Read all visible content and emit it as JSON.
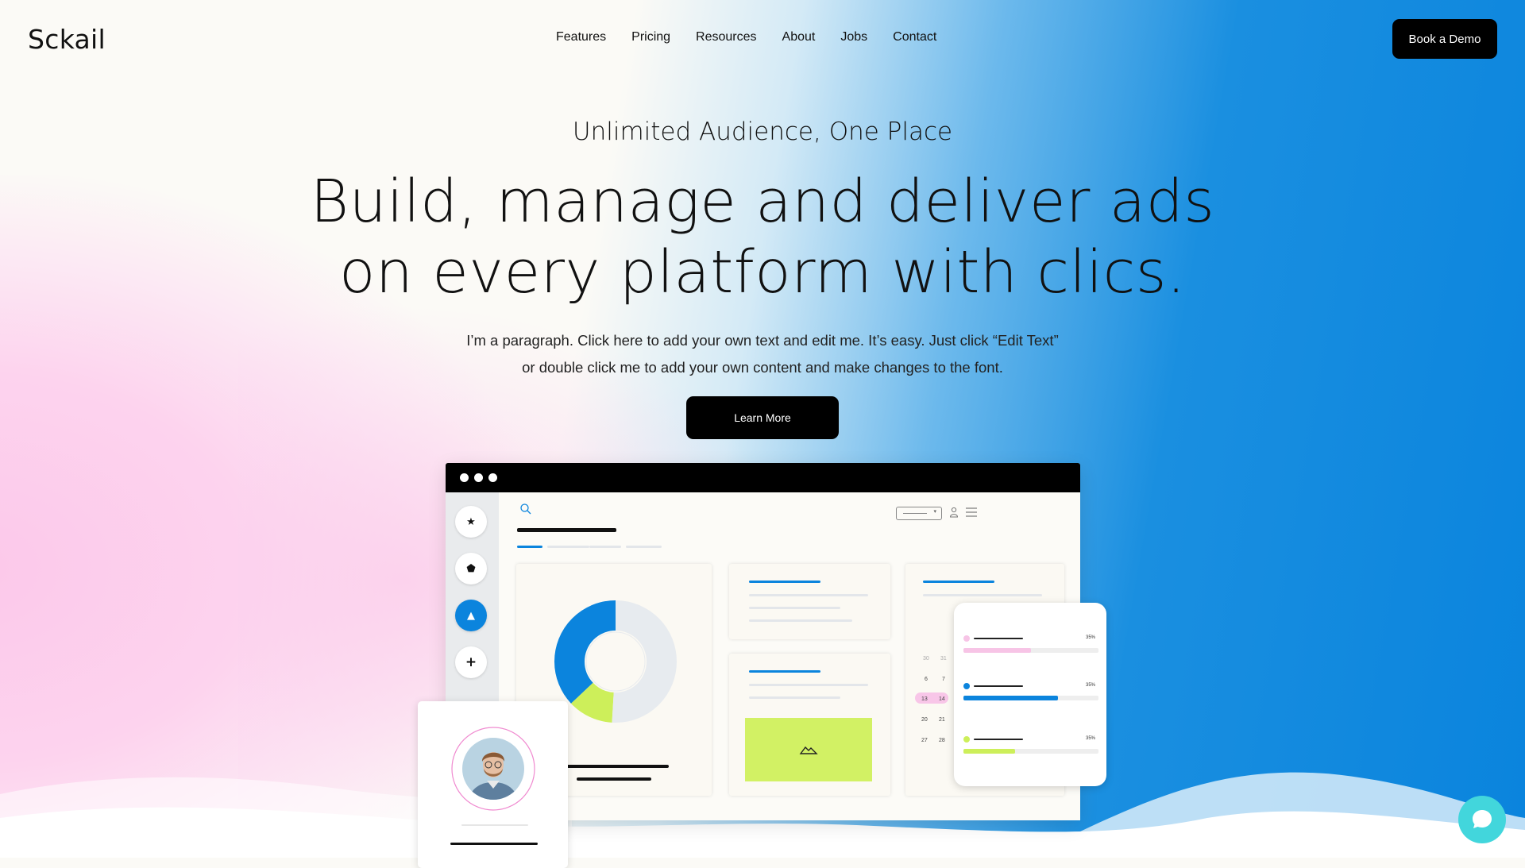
{
  "brand": {
    "name": "Sckail"
  },
  "nav": {
    "items": [
      "Features",
      "Pricing",
      "Resources",
      "About",
      "Jobs",
      "Contact"
    ],
    "cta": "Book a Demo"
  },
  "hero": {
    "eyebrow": "Unlimited Audience, One Place",
    "title_line1": "Build, manage and deliver ads",
    "title_line2": "on every platform with clics.",
    "paragraph_line1": "I’m a paragraph. Click here to add your own text and edit me. It’s easy. Just click “Edit Text”",
    "paragraph_line2": "or double click me to add your own content and make changes to the font.",
    "cta": "Learn More"
  },
  "mockup": {
    "sidebar_icons": [
      "star-icon",
      "pentagon-icon",
      "triangle-icon",
      "plus-icon"
    ],
    "active_sidebar_index": 2,
    "donut_segments": [
      {
        "color": "#0b84dd",
        "fraction": 0.37
      },
      {
        "color": "#cdef5a",
        "fraction": 0.12
      },
      {
        "color": "#e7ebef",
        "fraction": 0.51
      }
    ],
    "calendar": [
      "30",
      "31",
      "6",
      "7",
      "13",
      "14",
      "20",
      "21",
      "27",
      "28"
    ],
    "phone_rows": [
      {
        "label": "35%",
        "color": "#f7c4e6",
        "fill": 0.5
      },
      {
        "label": "35%",
        "color": "#0b84dd",
        "fill": 0.7
      },
      {
        "label": "35%",
        "color": "#cdef5a",
        "fill": 0.38
      }
    ]
  },
  "colors": {
    "accent": "#0b84dd",
    "lime": "#cdef5a",
    "pink": "#f7c4e6",
    "chat": "#42d6dc"
  }
}
